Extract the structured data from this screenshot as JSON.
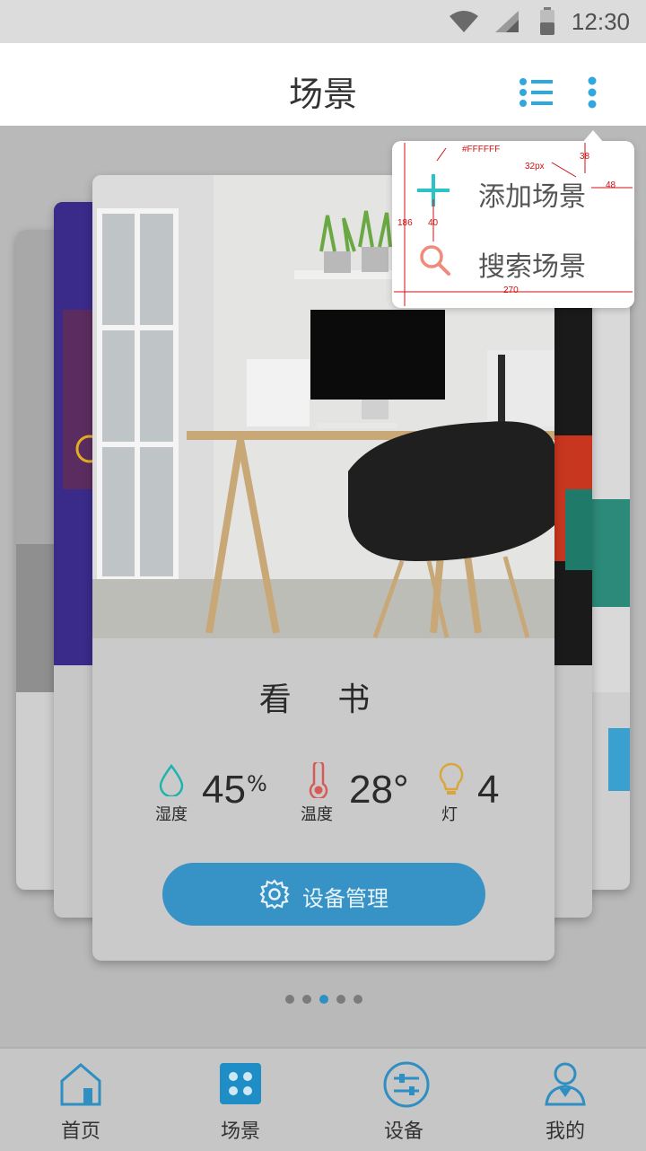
{
  "status_bar": {
    "time": "12:30",
    "icons": [
      "wifi-icon",
      "signal-icon",
      "battery-icon"
    ]
  },
  "header": {
    "title": "场景",
    "actions": [
      "list-icon",
      "more-vert-icon"
    ]
  },
  "popup_menu": {
    "items": [
      {
        "label": "添加场景",
        "icon": "plus-icon"
      },
      {
        "label": "搜索场景",
        "icon": "search-icon"
      }
    ],
    "annotations": {
      "color_note": "#FFFFFF",
      "corner": "32px",
      "top_gap": "38",
      "right_gap": "48",
      "height": "186",
      "icon_gap": "40",
      "width": "270"
    }
  },
  "scene_card": {
    "name": "看 书",
    "stats": [
      {
        "icon": "water-drop-icon",
        "label": "湿度",
        "value": "45",
        "unit": "%"
      },
      {
        "icon": "thermometer-icon",
        "label": "温度",
        "value": "28°",
        "unit": ""
      },
      {
        "icon": "bulb-icon",
        "label": "灯",
        "value": "4",
        "unit": ""
      }
    ],
    "button_label": "设备管理",
    "button_icon": "gear-icon"
  },
  "pager": {
    "count": 5,
    "active_index": 2
  },
  "bottom_nav": [
    {
      "label": "首页",
      "icon": "home-icon"
    },
    {
      "label": "场景",
      "icon": "scene-grid-icon",
      "active": true
    },
    {
      "label": "设备",
      "icon": "sliders-icon"
    },
    {
      "label": "我的",
      "icon": "user-icon"
    }
  ],
  "colors": {
    "accent": "#3793c6",
    "teal": "#2ac4c8",
    "search": "#f08a7a",
    "annotation": "#d01010"
  }
}
